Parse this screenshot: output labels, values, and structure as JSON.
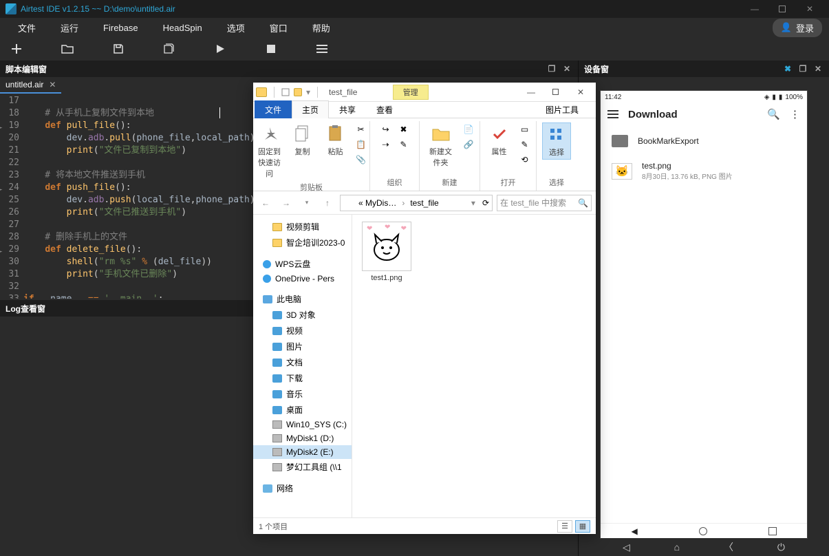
{
  "window": {
    "title": "Airtest IDE v1.2.15 ~~ D:\\demo\\untitled.air"
  },
  "menu": {
    "items": [
      "文件",
      "运行",
      "Firebase",
      "HeadSpin",
      "选项",
      "窗口",
      "帮助"
    ],
    "login": "登录"
  },
  "toolbar_icons": [
    "new",
    "open",
    "save",
    "saveall",
    "run",
    "stop",
    "more"
  ],
  "panel": {
    "editor_title": "脚本编辑窗",
    "device_title": "设备窗",
    "log_title": "Log查看窗",
    "tab_name": "untitled.air"
  },
  "code_lines": [
    {
      "n": 17,
      "t": ""
    },
    {
      "n": 18,
      "t": "    # 从手机上复制文件到本地",
      "cls": "cmt"
    },
    {
      "n": 19,
      "arrow": true,
      "tokens": [
        [
          "    ",
          ""
        ],
        [
          "def ",
          "kw"
        ],
        [
          "pull_file",
          "fn"
        ],
        [
          "()",
          ""
        ],
        [
          ":",
          ""
        ]
      ]
    },
    {
      "n": 20,
      "tokens": [
        [
          "        ",
          ""
        ],
        [
          "dev",
          "id"
        ],
        [
          ".",
          ""
        ],
        [
          "adb",
          "attr"
        ],
        [
          ".",
          ""
        ],
        [
          "pull",
          "fn"
        ],
        [
          "(",
          ""
        ],
        [
          "phone_file",
          "id"
        ],
        [
          ",",
          ""
        ],
        [
          "local_path",
          "id"
        ],
        [
          ")",
          ""
        ]
      ]
    },
    {
      "n": 21,
      "tokens": [
        [
          "        ",
          ""
        ],
        [
          "print",
          "fn"
        ],
        [
          "(",
          ""
        ],
        [
          "\"文件已复制到本地\"",
          "str"
        ],
        [
          ")",
          ""
        ]
      ]
    },
    {
      "n": 22,
      "t": ""
    },
    {
      "n": 23,
      "t": "    # 将本地文件推送到手机",
      "cls": "cmt"
    },
    {
      "n": 24,
      "arrow": true,
      "tokens": [
        [
          "    ",
          ""
        ],
        [
          "def ",
          "kw"
        ],
        [
          "push_file",
          "fn"
        ],
        [
          "()",
          ""
        ],
        [
          ":",
          ""
        ]
      ]
    },
    {
      "n": 25,
      "tokens": [
        [
          "        ",
          ""
        ],
        [
          "dev",
          "id"
        ],
        [
          ".",
          ""
        ],
        [
          "adb",
          "attr"
        ],
        [
          ".",
          ""
        ],
        [
          "push",
          "fn"
        ],
        [
          "(",
          ""
        ],
        [
          "local_file",
          "id"
        ],
        [
          ",",
          ""
        ],
        [
          "phone_path",
          "id"
        ],
        [
          ")",
          ""
        ]
      ]
    },
    {
      "n": 26,
      "tokens": [
        [
          "        ",
          ""
        ],
        [
          "print",
          "fn"
        ],
        [
          "(",
          ""
        ],
        [
          "\"文件已推送到手机\"",
          "str"
        ],
        [
          ")",
          ""
        ]
      ]
    },
    {
      "n": 27,
      "t": ""
    },
    {
      "n": 28,
      "t": "    # 删除手机上的文件",
      "cls": "cmt"
    },
    {
      "n": 29,
      "arrow": true,
      "tokens": [
        [
          "    ",
          ""
        ],
        [
          "def ",
          "kw"
        ],
        [
          "delete_file",
          "fn"
        ],
        [
          "()",
          ""
        ],
        [
          ":",
          ""
        ]
      ]
    },
    {
      "n": 30,
      "tokens": [
        [
          "        ",
          ""
        ],
        [
          "shell",
          "fn"
        ],
        [
          "(",
          ""
        ],
        [
          "\"rm %s\"",
          "str"
        ],
        [
          " % ",
          "op"
        ],
        [
          "(",
          ""
        ],
        [
          "del_file",
          "id"
        ],
        [
          "))",
          ""
        ]
      ]
    },
    {
      "n": 31,
      "tokens": [
        [
          "        ",
          ""
        ],
        [
          "print",
          "fn"
        ],
        [
          "(",
          ""
        ],
        [
          "\"手机文件已删除\"",
          "str"
        ],
        [
          ")",
          ""
        ]
      ]
    },
    {
      "n": 32,
      "t": ""
    },
    {
      "n": 33,
      "arrow": true,
      "tokens": [
        [
          "if ",
          "kw"
        ],
        [
          "__name__",
          "id"
        ],
        [
          " == ",
          "op"
        ],
        [
          "'__main__'",
          "str"
        ],
        [
          ":",
          ""
        ]
      ]
    }
  ],
  "explorer": {
    "title": "test_file",
    "manage_tab": "管理",
    "tabs": [
      "文件",
      "主页",
      "共享",
      "查看"
    ],
    "pic_tools": "图片工具",
    "ribbon_groups": {
      "clipboard": {
        "label": "剪贴板",
        "pin": "固定到快速访问",
        "copy": "复制",
        "paste": "粘贴"
      },
      "organize": {
        "label": "组织"
      },
      "new": {
        "label": "新建",
        "newfolder": "新建文件夹"
      },
      "open": {
        "label": "打开",
        "props": "属性"
      },
      "select": {
        "label": "选择",
        "select_btn": "选择"
      }
    },
    "breadcrumb": {
      "pre": "«  MyDis…",
      "sep": "›",
      "cur": "test_file"
    },
    "search_placeholder": "在 test_file 中搜索",
    "tree": [
      {
        "label": "视频剪辑",
        "icon": "folder",
        "indent": true
      },
      {
        "label": "智企培训2023-0",
        "icon": "folder",
        "indent": true
      },
      {
        "label": "WPS云盘",
        "icon": "cloud"
      },
      {
        "label": "OneDrive - Pers",
        "icon": "cloud"
      },
      {
        "label": "此电脑",
        "icon": "pc"
      },
      {
        "label": "3D 对象",
        "icon": "obj",
        "indent": true
      },
      {
        "label": "视频",
        "icon": "obj",
        "indent": true
      },
      {
        "label": "图片",
        "icon": "obj",
        "indent": true
      },
      {
        "label": "文档",
        "icon": "obj",
        "indent": true
      },
      {
        "label": "下载",
        "icon": "obj",
        "indent": true
      },
      {
        "label": "音乐",
        "icon": "obj",
        "indent": true
      },
      {
        "label": "桌面",
        "icon": "obj",
        "indent": true
      },
      {
        "label": "Win10_SYS (C:)",
        "icon": "drive",
        "indent": true
      },
      {
        "label": "MyDisk1 (D:)",
        "icon": "drive",
        "indent": true
      },
      {
        "label": "MyDisk2 (E:)",
        "icon": "drive",
        "indent": true,
        "sel": true
      },
      {
        "label": "梦幻工具组 (\\\\1",
        "icon": "drive",
        "indent": true
      },
      {
        "label": "网络",
        "icon": "net"
      }
    ],
    "file": {
      "name": "test1.png"
    },
    "status": "1 个项目"
  },
  "phone": {
    "time": "11:42",
    "battery": "100%",
    "header": "Download",
    "items": [
      {
        "name": "BookMarkExport",
        "type": "folder"
      },
      {
        "name": "test.png",
        "type": "image",
        "meta": "8月30日, 13.76 kB, PNG 图片"
      }
    ]
  }
}
